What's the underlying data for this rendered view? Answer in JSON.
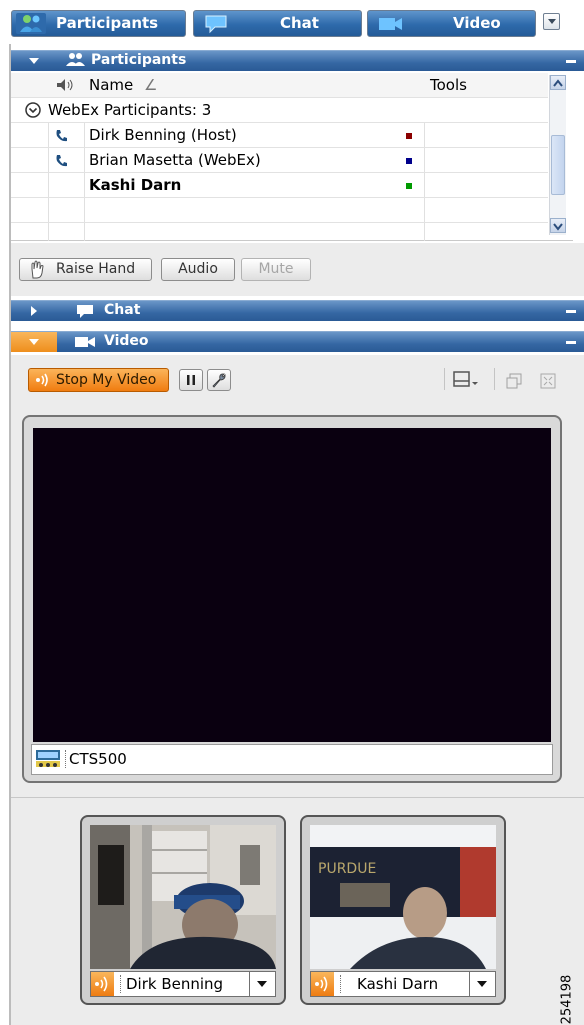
{
  "tabs": [
    {
      "label": "Participants",
      "icon": "participants-icon"
    },
    {
      "label": "Chat",
      "icon": "chat-bubble-icon"
    },
    {
      "label": "Video",
      "icon": "video-camera-icon"
    }
  ],
  "participants_panel": {
    "title": "Participants",
    "columns": {
      "name": "Name",
      "sort_indicator": "∠",
      "tools": "Tools"
    },
    "group_label": "WebEx Participants: 3",
    "rows": [
      {
        "name": "Dirk Benning (Host)",
        "phone": true,
        "bold": false,
        "color": "#8b0000"
      },
      {
        "name": "Brian Masetta (WebEx)",
        "phone": true,
        "bold": false,
        "color": "#00008b"
      },
      {
        "name": "Kashi Darn",
        "phone": false,
        "bold": true,
        "color": "#009a00"
      }
    ]
  },
  "actions": {
    "raise_hand": "Raise Hand",
    "audio": "Audio",
    "mute": "Mute"
  },
  "chat_panel": {
    "title": "Chat"
  },
  "video_panel": {
    "title": "Video",
    "stop_video": "Stop My Video",
    "main_caption": "CTS500",
    "thumbnails": [
      {
        "name": "Dirk Benning"
      },
      {
        "name": "Kashi Darn"
      }
    ]
  },
  "figure_id": "254198",
  "colors": {
    "accent_orange": "#ee8e1c",
    "header_blue": "#3567a3"
  }
}
